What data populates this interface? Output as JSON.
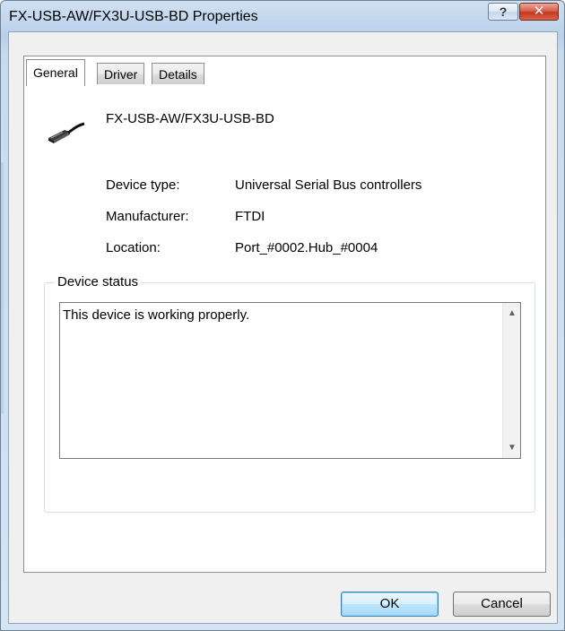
{
  "window": {
    "title": "FX-USB-AW/FX3U-USB-BD Properties",
    "help_label": "?",
    "close_label": "✕"
  },
  "tabs": [
    {
      "label": "General",
      "active": true
    },
    {
      "label": "Driver",
      "active": false
    },
    {
      "label": "Details",
      "active": false
    }
  ],
  "device": {
    "icon": "usb-cable-icon",
    "name": "FX-USB-AW/FX3U-USB-BD"
  },
  "properties": {
    "device_type_label": "Device type:",
    "device_type_value": "Universal Serial Bus controllers",
    "manufacturer_label": "Manufacturer:",
    "manufacturer_value": "FTDI",
    "location_label": "Location:",
    "location_value": "Port_#0002.Hub_#0004"
  },
  "status": {
    "group_label": "Device status",
    "text": "This device is working properly."
  },
  "buttons": {
    "ok": "OK",
    "cancel": "Cancel"
  }
}
